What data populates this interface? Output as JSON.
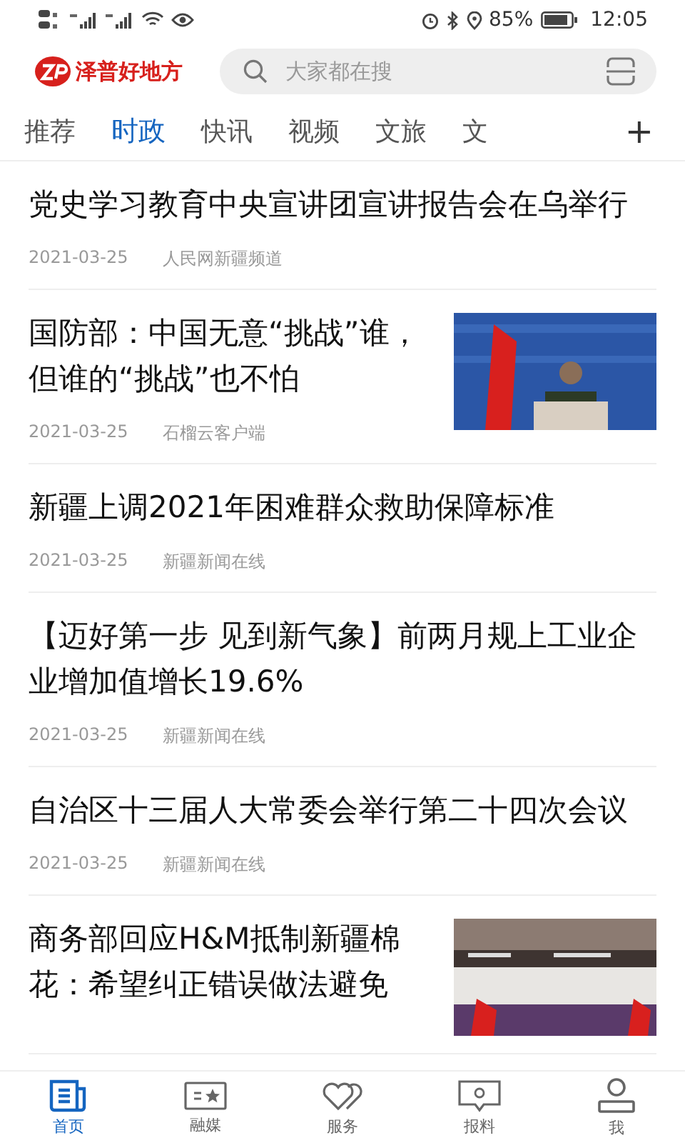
{
  "status_bar": {
    "battery": "85%",
    "time": "12:05"
  },
  "header": {
    "logo": "泽普好地方",
    "search": {
      "placeholder": "大家都在搜"
    }
  },
  "tabs": [
    {
      "label": "推荐",
      "selected": false
    },
    {
      "label": "时政",
      "selected": true
    },
    {
      "label": "快讯",
      "selected": false
    },
    {
      "label": "视频",
      "selected": false
    },
    {
      "label": "文旅",
      "selected": false
    },
    {
      "label": "文",
      "selected": false
    }
  ],
  "tab_add": "+",
  "articles": [
    {
      "kind": "text",
      "title": "党史学习教育中央宣讲团宣讲报告会在乌举行",
      "date": "2021-03-25",
      "source": "人民网新疆频道"
    },
    {
      "title": "国防部：中国无意“挑战”谁，但谁的“挑战”也不怕",
      "date": "2021-03-25",
      "source": "石榴云客户端"
    },
    {
      "kind": "text",
      "title": "新疆上调2021年困难群众救助保障标准",
      "date": "2021-03-25",
      "source": "新疆新闻在线"
    },
    {
      "kind": "text",
      "title": "【迈好第一步 见到新气象】前两月规上工业企业增加值增长19.6%",
      "date": "2021-03-25",
      "source": "新疆新闻在线"
    },
    {
      "kind": "text",
      "title": "自治区十三届人大常委会举行第二十四次会议",
      "date": "2021-03-25",
      "source": "新疆新闻在线"
    },
    {
      "title": "商务部回应H&M抵制新疆棉花：希望纠正错误做法避免"
    }
  ],
  "bottom_nav": [
    {
      "label": "首页",
      "selected": true
    },
    {
      "label": "融媒",
      "selected": false
    },
    {
      "label": "服务",
      "selected": false
    },
    {
      "label": "报料",
      "selected": false
    },
    {
      "label": "我",
      "selected": false
    }
  ]
}
